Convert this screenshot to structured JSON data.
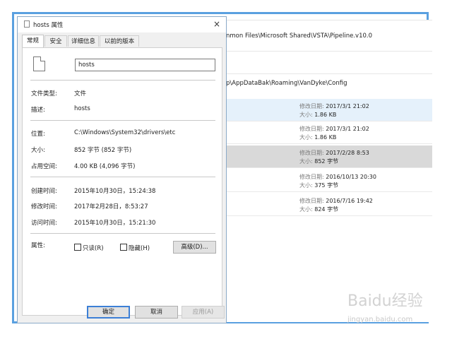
{
  "background_window": {
    "paths": [
      "nmon Files\\Microsoft Shared\\VSTA\\Pipeline.v10.0",
      "p\\AppDataBak\\Roaming\\VanDyke\\Config"
    ],
    "files": [
      {
        "modified_label": "修改日期:",
        "modified": "2017/3/1 21:02",
        "size_label": "大小:",
        "size": "1.86 KB"
      },
      {
        "modified_label": "修改日期:",
        "modified": "2017/3/1 21:02",
        "size_label": "大小:",
        "size": "1.86 KB"
      },
      {
        "modified_label": "修改日期:",
        "modified": "2017/2/28 8:53",
        "size_label": "大小:",
        "size": "852 字节"
      },
      {
        "modified_label": "修改日期:",
        "modified": "2016/10/13 20:30",
        "size_label": "大小:",
        "size": "375 字节"
      },
      {
        "modified_label": "修改日期:",
        "modified": "2016/7/16 19:42",
        "size_label": "大小:",
        "size": "824 字节"
      }
    ]
  },
  "dialog": {
    "title": "hosts 属性",
    "close": "×",
    "tabs": [
      "常规",
      "安全",
      "详细信息",
      "以前的版本"
    ],
    "file_name": "hosts",
    "fields": {
      "type_label": "文件类型:",
      "type_value": "文件",
      "desc_label": "描述:",
      "desc_value": "hosts",
      "location_label": "位置:",
      "location_value": "C:\\Windows\\System32\\drivers\\etc",
      "size_label": "大小:",
      "size_value": "852 字节 (852 字节)",
      "disk_label": "占用空间:",
      "disk_value": "4.00 KB (4,096 字节)",
      "created_label": "创建时间:",
      "created_value": "2015年10月30日，15:24:38",
      "modified_label": "修改时间:",
      "modified_value": "2017年2月28日，8:53:27",
      "accessed_label": "访问时间:",
      "accessed_value": "2015年10月30日，15:21:30",
      "attr_label": "属性:",
      "readonly_label": "只读(R)",
      "hidden_label": "隐藏(H)",
      "advanced_label": "高级(D)..."
    },
    "buttons": {
      "ok": "确定",
      "cancel": "取消",
      "apply": "应用(A)"
    }
  },
  "watermark": {
    "brand": "Baidu经验",
    "url": "jingyan.baidu.com"
  }
}
